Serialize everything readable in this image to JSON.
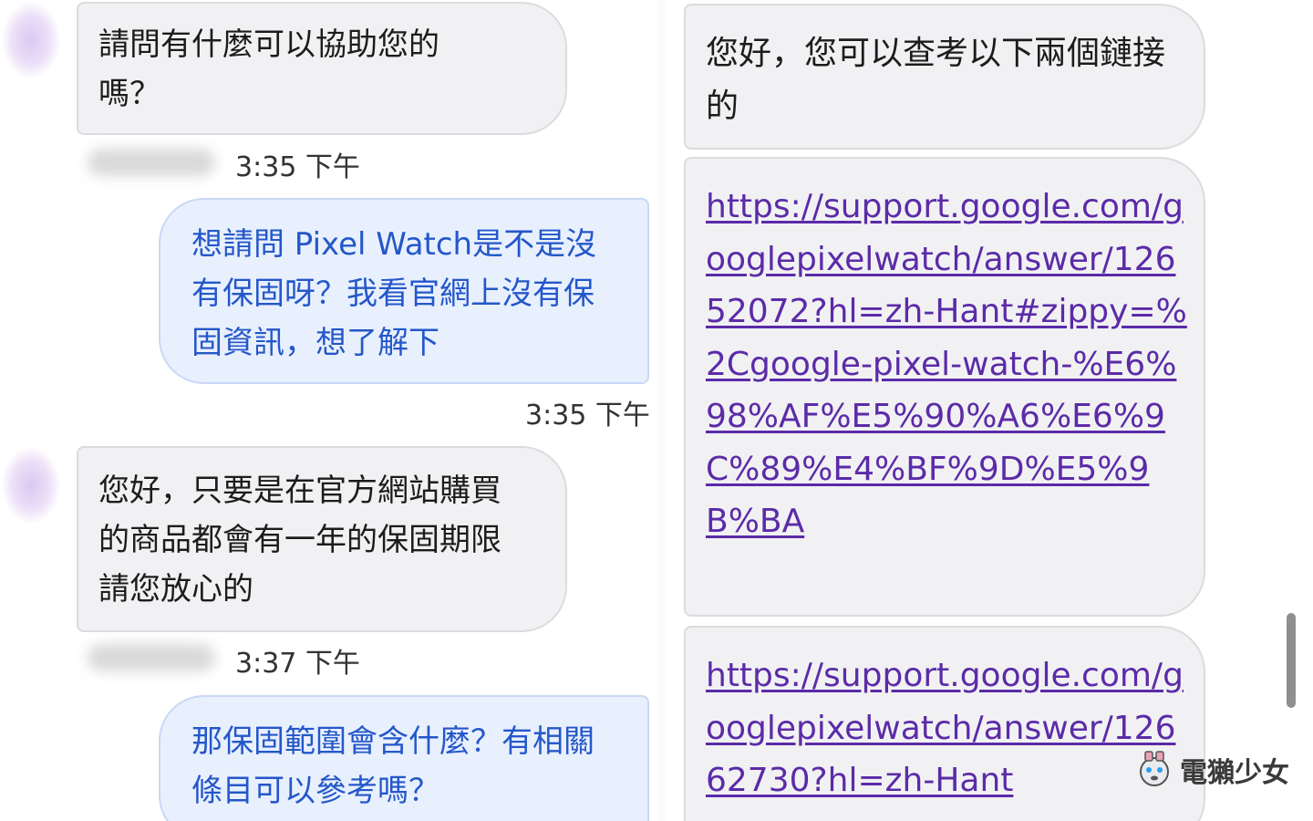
{
  "left": {
    "msg1": {
      "text": "請問有什麼可以協助您的嗎？",
      "time": "3:35 下午"
    },
    "msg2": {
      "text": "想請問 Pixel Watch是不是沒有保固呀？我看官網上沒有保固資訊，想了解下",
      "time": "3:35 下午"
    },
    "msg3": {
      "text": "您好，只要是在官方網站購買的商品都會有一年的保固期限請您放心的",
      "time": "3:37 下午"
    },
    "msg4": {
      "text": "那保固範圍會含什麼？有相關條目可以參考嗎？"
    }
  },
  "right": {
    "msg1": {
      "text": "您好，您可以查考以下兩個鏈接的"
    },
    "link1": {
      "text": "https://support.google.com/googlepixelwatch/answer/12652072?hl=zh-Hant#zippy=%2Cgoogle-pixel-watch-%E6%98%AF%E5%90%A6%E6%9C%89%E4%BF%9D%E5%9B%BA"
    },
    "link2": {
      "text": "https://support.google.com/googlepixelwatch/answer/12662730?hl=zh-Hant"
    }
  },
  "watermark": {
    "text": "電獺少女"
  },
  "colors": {
    "bubble_in": "#f1f1f3",
    "bubble_out": "#e8f0fe",
    "outgoing_text": "#2457c9",
    "link": "#5b2ba8"
  }
}
